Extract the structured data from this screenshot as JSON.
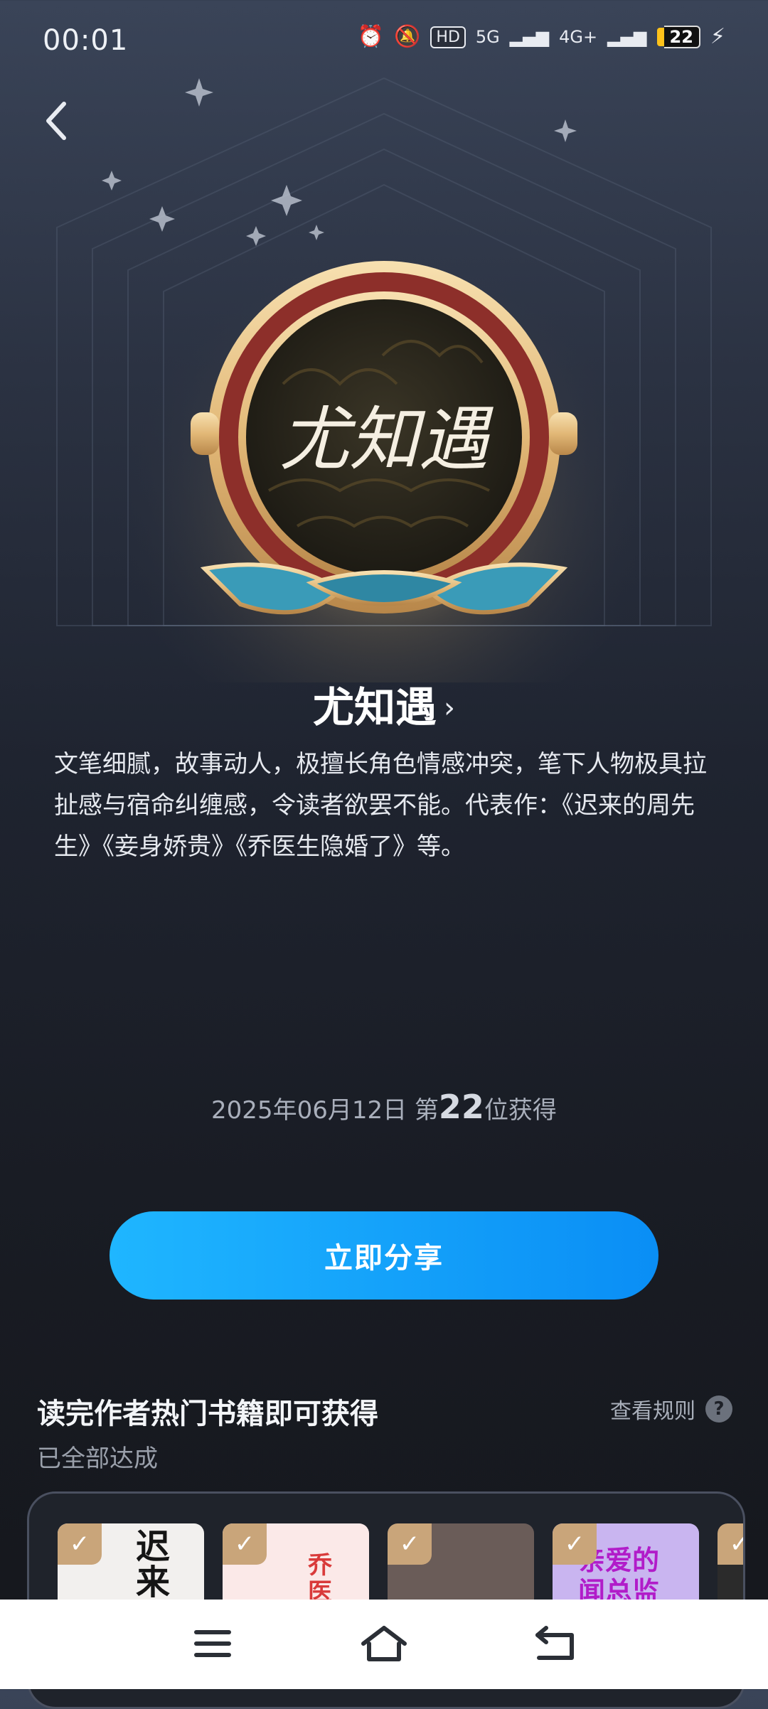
{
  "status_bar": {
    "time": "00:01",
    "hd_label": "HD",
    "network_5g": "5G",
    "network_4g": "4G+",
    "battery_level": "22"
  },
  "badge": {
    "author_name": "尤知遇",
    "medal_signature": "尤知遇",
    "description": "文笔细腻，故事动人，极擅长角色情感冲突，笔下人物极具拉扯感与宿命纠缠感，令读者欲罢不能。代表作：《迟来的周先生》《妾身娇贵》《乔医生隐婚了》等。",
    "earned_date": "2025年06月12日",
    "rank_prefix": "第",
    "rank_number": "22",
    "rank_suffix": "位获得"
  },
  "actions": {
    "share_label": "立即分享"
  },
  "conditions": {
    "title": "读完作者热门书籍即可获得",
    "status": "已全部达成",
    "rules_label": "查看规则",
    "help_glyph": "?"
  },
  "books": [
    {
      "cover_text": "迟来的周",
      "bg": "#f2f0ee",
      "ink": "#151515",
      "checked": true
    },
    {
      "cover_text": "乔医隐",
      "bg": "#fbe9e8",
      "ink": "#d93a3a",
      "checked": true
    },
    {
      "cover_text": "",
      "bg": "#6a5c58",
      "ink": "#ffffff",
      "checked": true
    },
    {
      "cover_text": "亲爱的闻总监",
      "bg": "#c9b5f0",
      "ink": "#b11cc9",
      "checked": true
    },
    {
      "cover_text": "",
      "bg": "#2b2b2b",
      "ink": "#ffffff",
      "checked": true
    }
  ],
  "colors": {
    "accent_blue": "#0a8ef5",
    "check_gold": "#c9a57a",
    "medal_gold": "#e2b877",
    "medal_teal": "#3a9bb8"
  }
}
